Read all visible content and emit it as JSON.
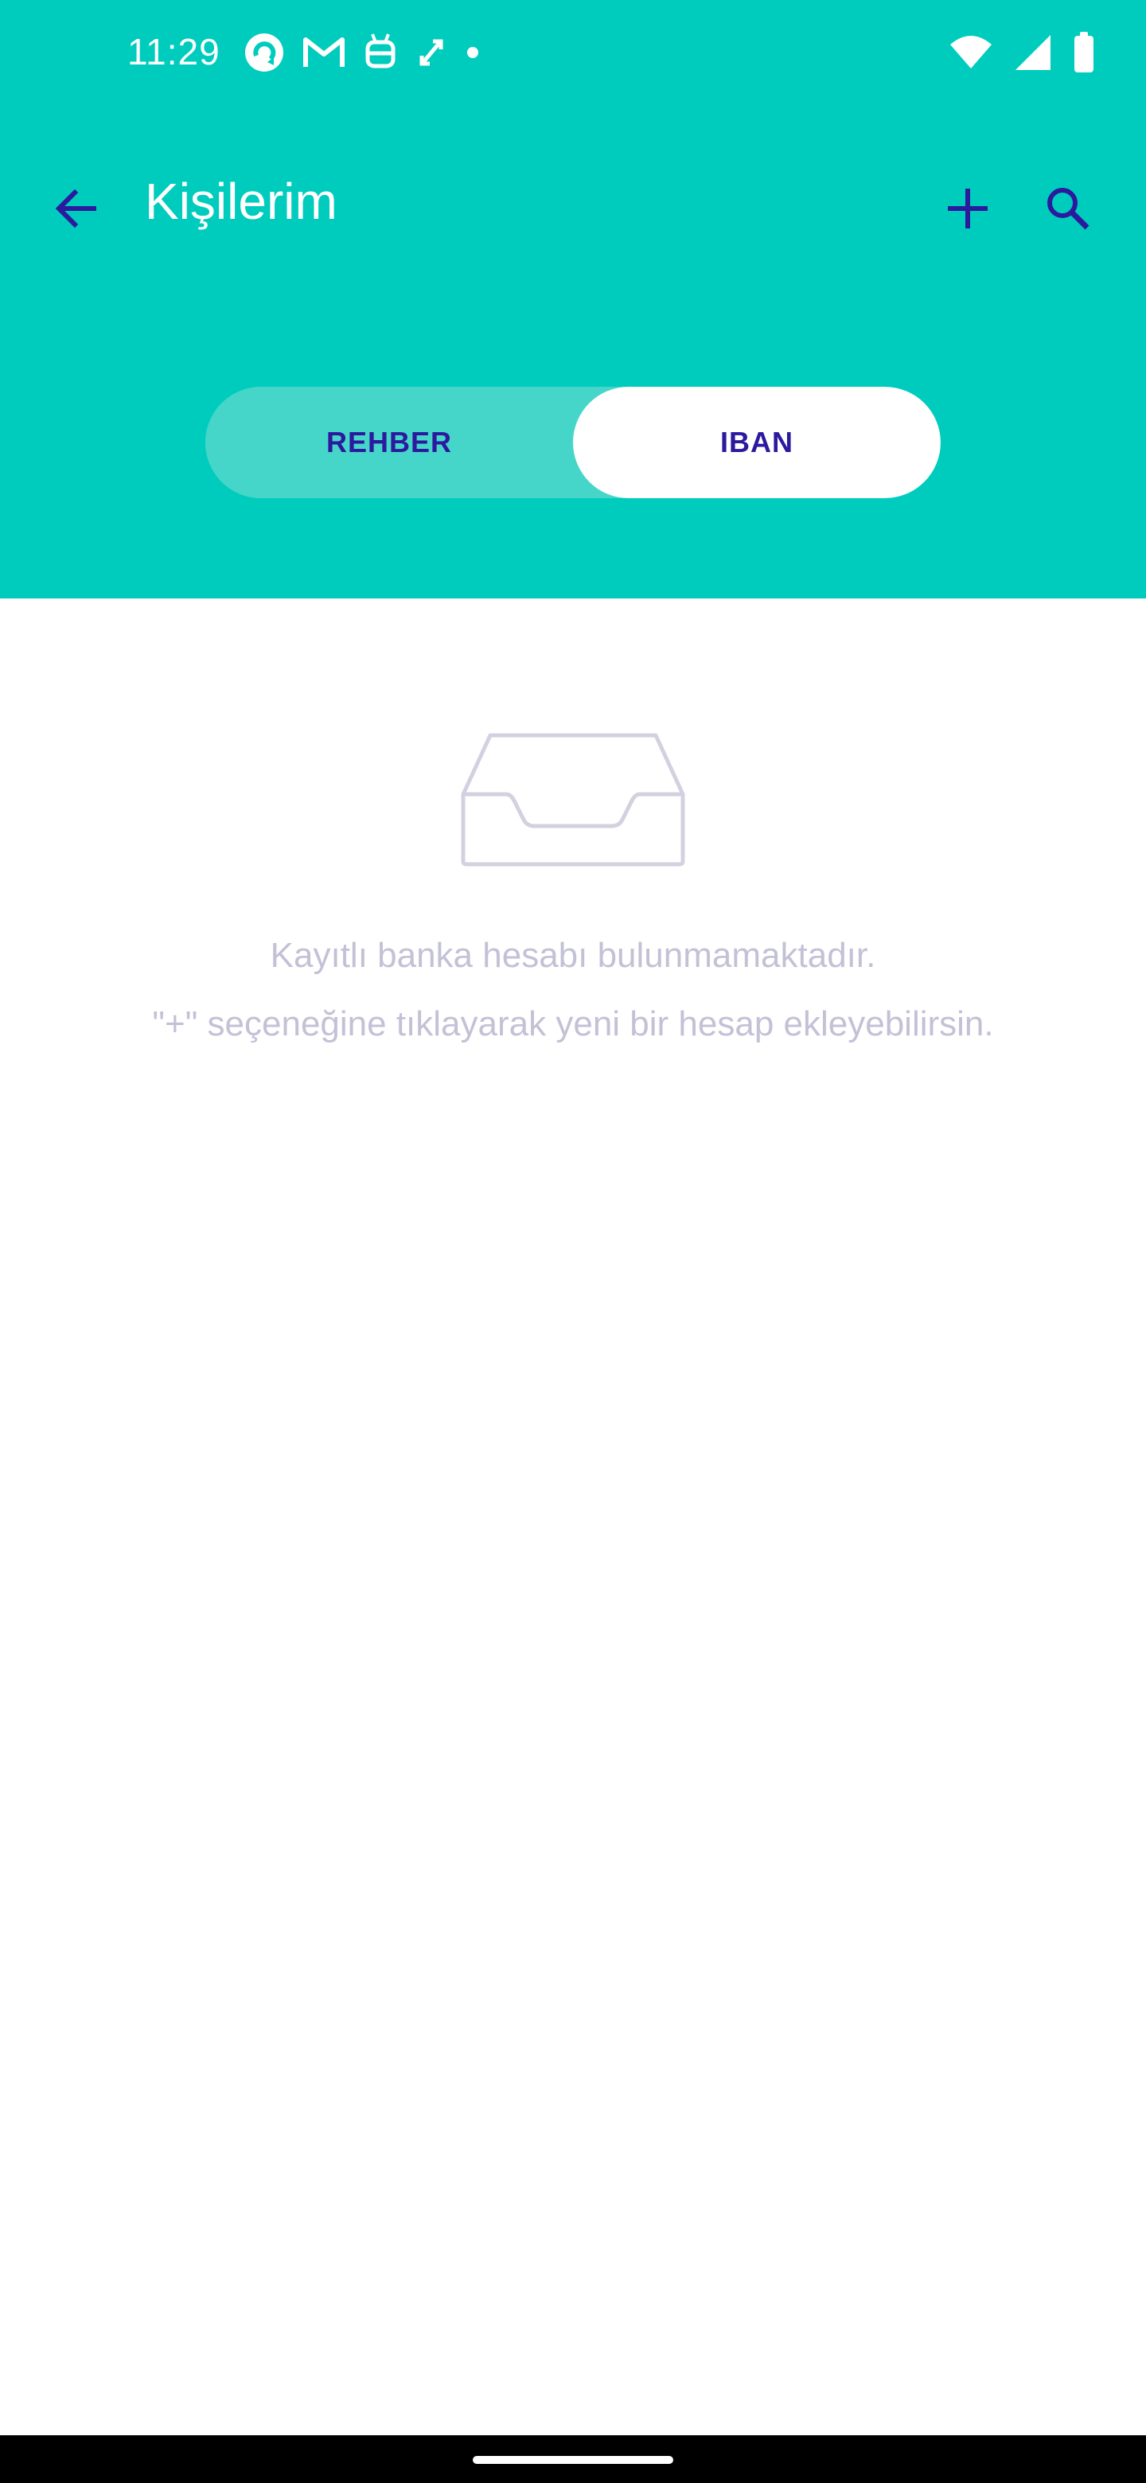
{
  "status_bar": {
    "time": "11:29",
    "notification_icons": [
      "refresh-app-icon",
      "gmail-icon",
      "android-debug-icon",
      "link-icon",
      "dot-icon"
    ],
    "right_icons": [
      "wifi-icon",
      "cellular-signal-icon",
      "battery-icon"
    ]
  },
  "app_bar": {
    "title": "Kişilerim",
    "icons": [
      "back-arrow-icon",
      "plus-icon",
      "search-icon"
    ]
  },
  "segment": {
    "tabs": [
      {
        "label": "REHBER",
        "selected": false
      },
      {
        "label": "IBAN",
        "selected": true
      }
    ]
  },
  "empty_state": {
    "icon": "inbox-tray-icon",
    "line1": "Kayıtlı banka hesabı bulunmamaktadır.",
    "line2": "\"+\" seçeneğine tıklayarak yeni bir hesap ekleyebilirsin."
  },
  "colors": {
    "header_bg": "#00CCBE",
    "segment_inactive_bg": "#46D6C9",
    "accent": "#2B1A9E",
    "empty_text": "#C3C1D6",
    "background": "#FFFFFF"
  }
}
